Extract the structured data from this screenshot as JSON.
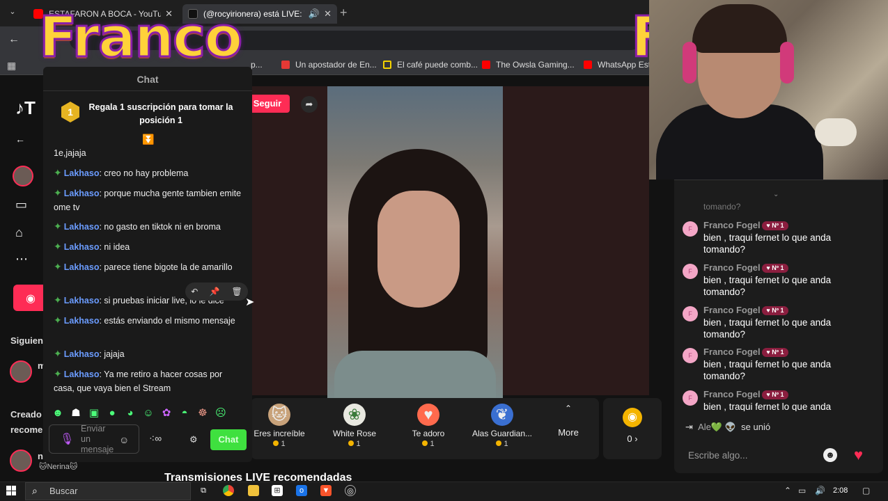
{
  "browser": {
    "tabs": [
      {
        "title": "ESTAFARON A BOCA - YouTube",
        "favicon_color": "#ff0000"
      },
      {
        "title": "(@rocyirionera) está LIVE: T",
        "favicon_color": "#ffffff"
      }
    ],
    "bookmarks": [
      {
        "label": "p...",
        "color": "#888888"
      },
      {
        "label": "Un apostador de En...",
        "color": "#e53935"
      },
      {
        "label": "El café puede comb...",
        "color": "#f5d300"
      },
      {
        "label": "The Owsla Gaming...",
        "color": "#ff0000"
      },
      {
        "label": "WhatsApp Estil",
        "color": "#ff0000"
      }
    ]
  },
  "overlay": {
    "streamer_name": "Franco",
    "streamer_name_right": "F"
  },
  "tiktok": {
    "logo": "T",
    "follow_label": "Seguir",
    "sidebar": {
      "following_label": "Siguien",
      "creators_label": "Creado",
      "recommended_label": "recome",
      "user_initial": "m",
      "user_sub": "m",
      "user2_initial": "n"
    },
    "gifts": [
      {
        "name": "Eres increíble",
        "price": "1",
        "icon": "cat-icon"
      },
      {
        "name": "White Rose",
        "price": "1",
        "icon": "rose-icon"
      },
      {
        "name": "Te adoro",
        "price": "1",
        "icon": "heart-icon"
      },
      {
        "name": "Alas Guardian...",
        "price": "1",
        "icon": "wings-icon"
      }
    ],
    "more_label": "More",
    "coins_label": "0 ›",
    "recommended_title": "Transmisiones LIVE recomendadas"
  },
  "left_chat": {
    "title": "Chat",
    "sub_badge": "1",
    "sub_banner": "Regala 1 suscripción para tomar la posición 1",
    "first_line": "1e,jajaja",
    "messages": [
      {
        "user": "Lakhaso",
        "text": ": creo no hay problema"
      },
      {
        "user": "Lakhaso",
        "text": ": porque mucha gente tambien emite ome tv"
      },
      {
        "user": "Lakhaso",
        "text": ": no gasto en tiktok ni en broma"
      },
      {
        "user": "Lakhaso",
        "text": ": ni idea"
      },
      {
        "user": "Lakhaso",
        "text": ": parece tiene bigote la de amarillo"
      },
      {
        "user": "Lakhaso",
        "text": ": si pruebas iniciar live, lo le dice"
      },
      {
        "user": "Lakhaso",
        "text": ": estás enviando el mismo mensaje"
      },
      {
        "user": "Lakhaso",
        "text": ": jajaja"
      },
      {
        "user": "Lakhaso",
        "text": ": Ya me retiro a hacer cosas por casa, que vaya bien el Stream"
      }
    ],
    "input_placeholder": "Enviar un mensaje",
    "send_label": "Chat",
    "footer_user": "🐱Nerina🐱"
  },
  "right_chat": {
    "cut_text": "tomando?",
    "messages": [
      {
        "avatar": "F",
        "name": "Franco Fogel",
        "badge": "♥ Nº 1",
        "text": "bien , traqui fernet lo que anda tomando?"
      },
      {
        "avatar": "F",
        "name": "Franco Fogel",
        "badge": "♥ Nº 1",
        "text": "bien , traqui fernet lo que anda tomando?"
      },
      {
        "avatar": "F",
        "name": "Franco Fogel",
        "badge": "♥ Nº 1",
        "text": "bien , traqui fernet lo que anda tomando?"
      },
      {
        "avatar": "F",
        "name": "Franco Fogel",
        "badge": "♥ Nº 1",
        "text": "bien , traqui fernet lo que anda tomando?"
      },
      {
        "avatar": "F",
        "name": "Franco Fogel",
        "badge": "♥ Nº 1",
        "text": "bien , traqui fernet lo que anda tomando?"
      }
    ],
    "join_name": "Ale💚 👽",
    "join_text": "se unió",
    "input_placeholder": "Escribe algo..."
  },
  "taskbar": {
    "search_label": "Buscar",
    "time": "2:08"
  },
  "colors": {
    "accent": "#fe2c55",
    "chat_user": "#6b9cff",
    "send_button": "#3fe03f"
  }
}
